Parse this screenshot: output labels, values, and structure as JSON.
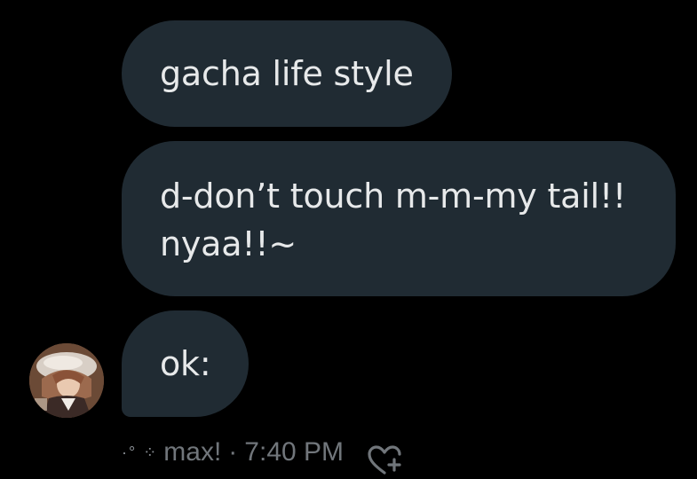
{
  "messages": [
    {
      "text": "gacha life style"
    },
    {
      "text": "d-don’t touch m-m-my tail!!\nnyaa!!~"
    },
    {
      "text": "ok:"
    }
  ],
  "sender": {
    "name_decoration": "·° ⁘",
    "name": "max!",
    "separator": "·",
    "time": "7:40 PM",
    "avatar_icon": "avatar-image"
  },
  "reaction_icon": "heart-plus-icon",
  "colors": {
    "background": "#000000",
    "bubble": "#202b33",
    "text": "#e7e9ea",
    "meta": "#71767b"
  }
}
